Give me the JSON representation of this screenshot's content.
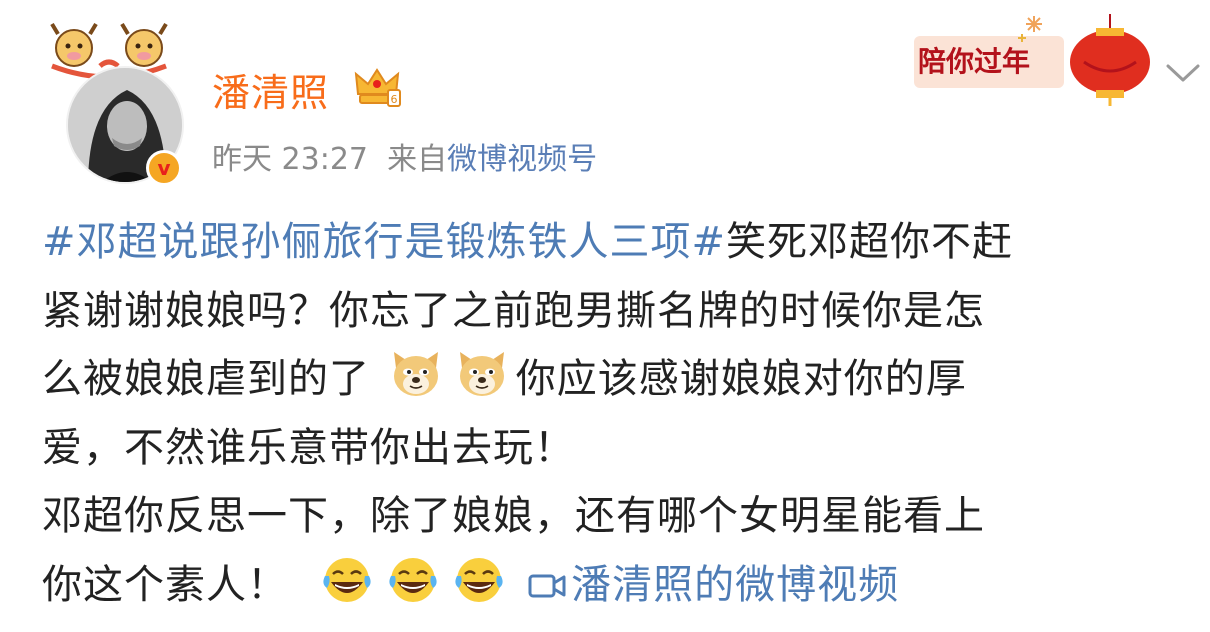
{
  "post": {
    "author_name": "潘清照",
    "timestamp_day": "昨天",
    "timestamp_time": "23:27",
    "source_prefix": "来自",
    "source_name": "微博视频号",
    "banner_label": "陪你过年",
    "hashtag": "#邓超说跟孙俪旅行是锻炼铁人三项#",
    "body_line1_rest": "笑死邓超你不赶",
    "body_line2": "紧谢谢娘娘吗？你忘了之前跑男撕名牌的时候你是怎",
    "body_line3_a": "么被娘娘虐到的了",
    "body_line3_b": "你应该感谢娘娘对你的厚",
    "body_line4": "爱，不然谁乐意带你出去玩！",
    "body_line5": "邓超你反思一下，除了娘娘，还有哪个女明星能看上",
    "body_line6": "你这个素人！",
    "video_link_label": "潘清照的微博视频"
  },
  "icons": {
    "emoji_doge": "doge-emoji",
    "emoji_laugh": "laugh-cry-emoji",
    "verified": "verified-badge-icon",
    "vip": "crown-icon",
    "video": "video-camera-icon",
    "menu": "chevron-down-icon"
  },
  "colors": {
    "name": "#f86c1a",
    "link": "#4e7cb5",
    "meta": "#8a8a8a",
    "banner": "#b3121b"
  }
}
